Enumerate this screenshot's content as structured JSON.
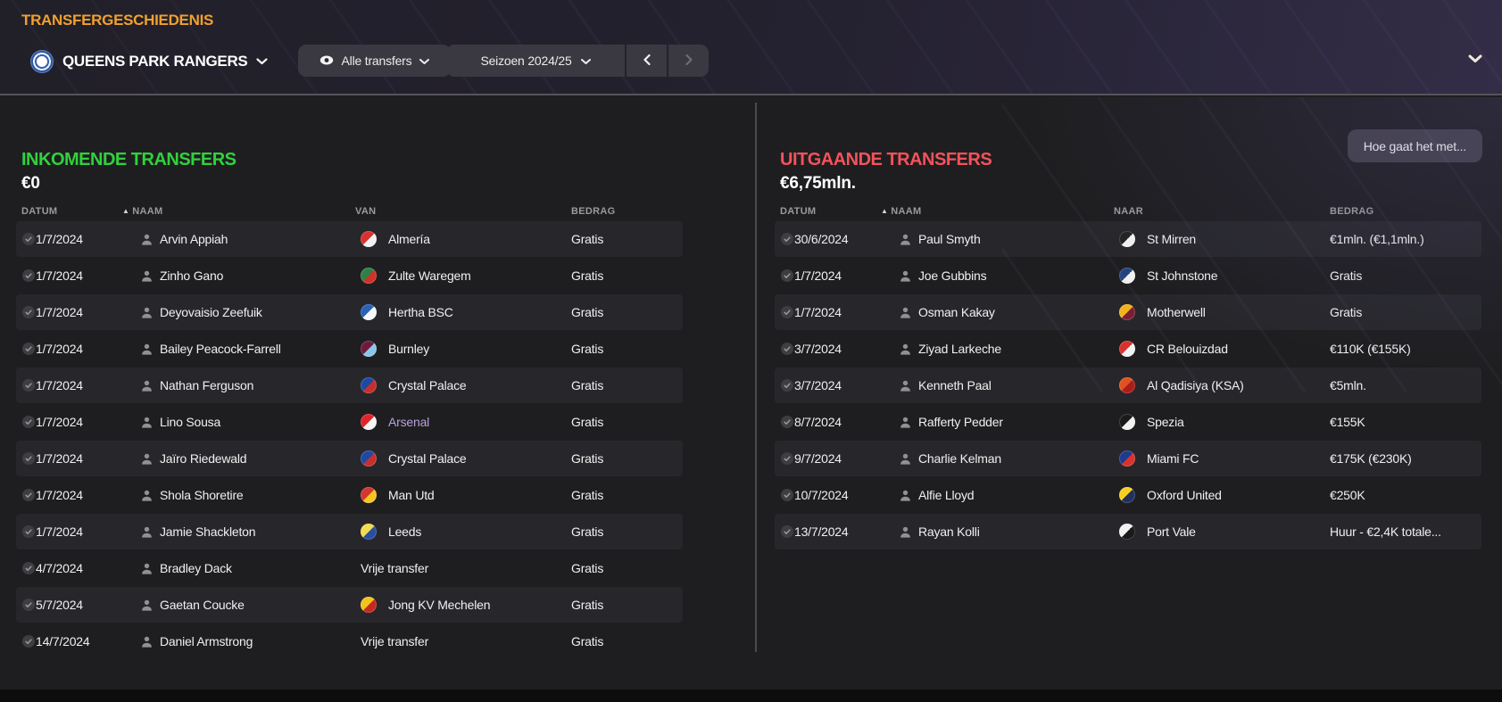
{
  "header": {
    "page_title": "TRANSFERGESCHIEDENIS",
    "club_name": "QUEENS PARK RANGERS",
    "filter_label": "Alle transfers",
    "season_label": "Seizoen 2024/25",
    "prev_label": "‹",
    "next_label": "›"
  },
  "colors": {
    "accent_orange": "#f0a02f",
    "accent_green": "#31d13d",
    "accent_red": "#f4525b",
    "link_purple": "#b9a1de",
    "header_bg": "#2a2738",
    "row_alt_bg": "#27272b"
  },
  "icons": {
    "sort_asc": "▲",
    "check": "✓",
    "chevron_down": "⌄",
    "eye": "👁",
    "person": "player-silhouette"
  },
  "incoming": {
    "title": "INKOMENDE TRANSFERS",
    "total": "€0",
    "columns": {
      "date": "DATUM",
      "name": "NAAM",
      "club": "VAN",
      "fee": "BEDRAG"
    },
    "rows": [
      {
        "date": "1/7/2024",
        "name": "Arvin Appiah",
        "club": "Almería",
        "fee": "Gratis",
        "badge": [
          "#d8322f",
          "#f2f2f2"
        ]
      },
      {
        "date": "1/7/2024",
        "name": "Zinho Gano",
        "club": "Zulte Waregem",
        "fee": "Gratis",
        "badge": [
          "#2e8046",
          "#d03228"
        ]
      },
      {
        "date": "1/7/2024",
        "name": "Deyovaisio Zeefuik",
        "club": "Hertha BSC",
        "fee": "Gratis",
        "badge": [
          "#2b62b5",
          "#f5f8fc"
        ]
      },
      {
        "date": "1/7/2024",
        "name": "Bailey Peacock-Farrell",
        "club": "Burnley",
        "fee": "Gratis",
        "badge": [
          "#races",
          "#8ac6ea"
        ],
        "badge_fix": [
          "#6d1a3d",
          "#8ac6ea"
        ]
      },
      {
        "date": "1/7/2024",
        "name": "Nathan Ferguson",
        "club": "Crystal Palace",
        "fee": "Gratis",
        "badge": [
          "#1f49a0",
          "#c4302e"
        ]
      },
      {
        "date": "1/7/2024",
        "name": "Lino Sousa",
        "club": "Arsenal",
        "fee": "Gratis",
        "badge": [
          "#e0242b",
          "#f5f5f5"
        ],
        "club_color": "#b9a1de"
      },
      {
        "date": "1/7/2024",
        "name": "Jaïro Riedewald",
        "club": "Crystal Palace",
        "fee": "Gratis",
        "badge": [
          "#1f49a0",
          "#c4302e"
        ]
      },
      {
        "date": "1/7/2024",
        "name": "Shola Shoretire",
        "club": "Man Utd",
        "fee": "Gratis",
        "badge": [
          "#d3362d",
          "#f7c520"
        ]
      },
      {
        "date": "1/7/2024",
        "name": "Jamie Shackleton",
        "club": "Leeds",
        "fee": "Gratis",
        "badge": [
          "#f3dc4d",
          "#2a4fa0"
        ]
      },
      {
        "date": "4/7/2024",
        "name": "Bradley Dack",
        "club": "Vrije transfer",
        "fee": "Gratis",
        "badge": null
      },
      {
        "date": "5/7/2024",
        "name": "Gaetan Coucke",
        "club": "Jong KV Mechelen",
        "fee": "Gratis",
        "badge": [
          "#f2c21e",
          "#c42a22"
        ]
      },
      {
        "date": "14/7/2024",
        "name": "Daniel Armstrong",
        "club": "Vrije transfer",
        "fee": "Gratis",
        "badge": null
      }
    ]
  },
  "outgoing": {
    "title": "UITGAANDE TRANSFERS",
    "total": "€6,75mln.",
    "action_button": "Hoe gaat het met...",
    "columns": {
      "date": "DATUM",
      "name": "NAAM",
      "club": "NAAR",
      "fee": "BEDRAG"
    },
    "rows": [
      {
        "date": "30/6/2024",
        "name": "Paul Smyth",
        "club": "St Mirren",
        "fee": "€1mln. (€1,1mln.)",
        "badge": [
          "#222222",
          "#f2f2f2"
        ]
      },
      {
        "date": "1/7/2024",
        "name": "Joe Gubbins",
        "club": "St Johnstone",
        "fee": "Gratis",
        "badge": [
          "#24427e",
          "#f2f2f2"
        ]
      },
      {
        "date": "1/7/2024",
        "name": "Osman Kakay",
        "club": "Motherwell",
        "fee": "Gratis",
        "badge": [
          "#f2b21e",
          "#7a1f33"
        ]
      },
      {
        "date": "3/7/2024",
        "name": "Ziyad Larkeche",
        "club": "CR Belouizdad",
        "fee": "€110K (€155K)",
        "badge": [
          "#d8322f",
          "#f2f2f2"
        ]
      },
      {
        "date": "3/7/2024",
        "name": "Kenneth Paal",
        "club": "Al Qadisiya (KSA)",
        "fee": "€5mln.",
        "badge": [
          "#e0531f",
          "#a91d1b"
        ]
      },
      {
        "date": "8/7/2024",
        "name": "Rafferty Pedder",
        "club": "Spezia",
        "fee": "€155K",
        "badge": [
          "#1a1a1a",
          "#f2f2f2"
        ]
      },
      {
        "date": "9/7/2024",
        "name": "Charlie Kelman",
        "club": "Miami FC",
        "fee": "€175K (€230K)",
        "badge": [
          "#203a8c",
          "#d8322f"
        ]
      },
      {
        "date": "10/7/2024",
        "name": "Alfie Lloyd",
        "club": "Oxford United",
        "fee": "€250K",
        "badge": [
          "#f5d022",
          "#23305c"
        ]
      },
      {
        "date": "13/7/2024",
        "name": "Rayan Kolli",
        "club": "Port Vale",
        "fee": "Huur - €2,4K totale...",
        "badge": [
          "#f2f2f2",
          "#1a1a1a"
        ]
      }
    ]
  }
}
